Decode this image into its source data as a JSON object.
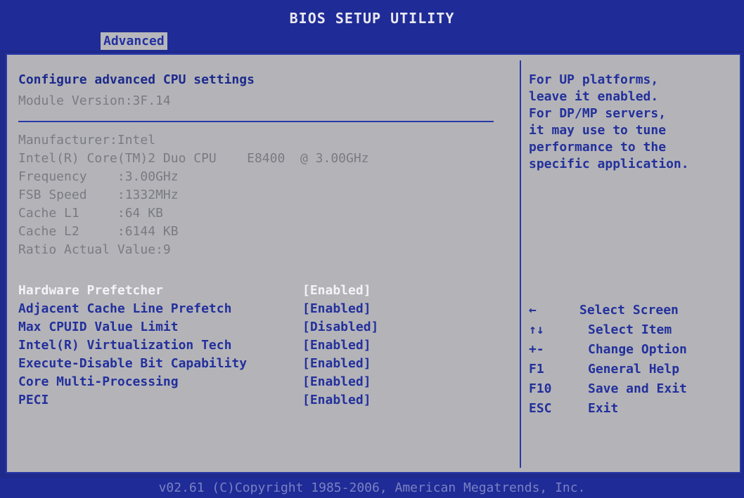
{
  "header": {
    "title": "BIOS SETUP UTILITY",
    "active_tab": "Advanced"
  },
  "main": {
    "heading": "Configure advanced CPU settings",
    "module_version": "Module Version:3F.14",
    "cpu_info": {
      "manufacturer": "Manufacturer:Intel",
      "model": "Intel(R) Core(TM)2 Duo CPU    E8400  @ 3.00GHz",
      "frequency": "Frequency    :3.00GHz",
      "fsb_speed": "FSB Speed    :1332MHz",
      "cache_l1": "Cache L1     :64 KB",
      "cache_l2": "Cache L2     :6144 KB",
      "ratio": "Ratio Actual Value:9"
    },
    "options": [
      {
        "label": "Hardware Prefetcher",
        "value": "[Enabled]",
        "selected": true
      },
      {
        "label": "Adjacent Cache Line Prefetch",
        "value": "[Enabled]",
        "selected": false
      },
      {
        "label": "Max CPUID Value Limit",
        "value": "[Disabled]",
        "selected": false
      },
      {
        "label": "Intel(R) Virtualization Tech",
        "value": "[Enabled]",
        "selected": false
      },
      {
        "label": "Execute-Disable Bit Capability",
        "value": "[Enabled]",
        "selected": false
      },
      {
        "label": "Core Multi-Processing",
        "value": "[Enabled]",
        "selected": false
      },
      {
        "label": "PECI",
        "value": "[Enabled]",
        "selected": false
      }
    ]
  },
  "help": {
    "lines": [
      "For UP platforms,",
      "leave it enabled.",
      "For DP/MP servers,",
      "it may use to tune",
      "performance to the",
      "specific application."
    ]
  },
  "keys": [
    {
      "key": "←",
      "desc": "Select Screen"
    },
    {
      "key": "↑↓",
      "desc": "Select Item"
    },
    {
      "key": "+-",
      "desc": "Change Option"
    },
    {
      "key": "F1",
      "desc": "General Help"
    },
    {
      "key": "F10",
      "desc": "Save and Exit"
    },
    {
      "key": "ESC",
      "desc": "Exit"
    }
  ],
  "footer": {
    "copyright": "v02.61 (C)Copyright 1985-2006, American Megatrends, Inc."
  },
  "colors": {
    "frame_blue": "#1f2b96",
    "panel_gray": "#b4b4b8",
    "text_blue": "#23309c",
    "highlight_white": "#f4f4f8",
    "info_gray": "#7a7a82"
  }
}
